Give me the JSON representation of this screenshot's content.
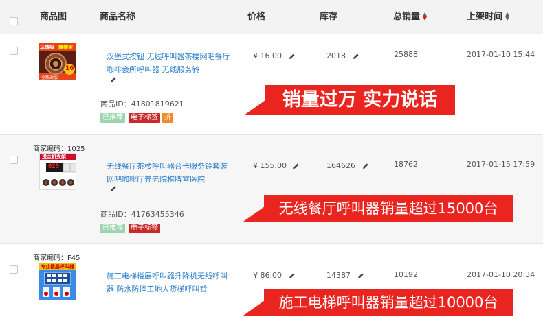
{
  "header": {
    "col_image": "商品图",
    "col_name": "商品名称",
    "col_price": "价格",
    "col_stock": "库存",
    "col_sales": "总销量",
    "col_listed": "上架时间"
  },
  "rows": [
    {
      "title": "汉堡式按钮 无线呼叫器茶楼网吧餐厅咖啡会所呼叫器 无线服务铃",
      "price": "¥ 16.00",
      "stock": "2018",
      "sales": "25888",
      "listed": "2017-01-10 15:44",
      "product_id": "商品ID：41801819621",
      "tags": [
        "已推荐",
        "电子标签",
        "折"
      ],
      "banner": "销量过万 实力说话",
      "thumb_text": [
        "玩转吸",
        "震撼型",
        "全新改版",
        "16"
      ]
    },
    {
      "merchant_code": "商家编码：1025",
      "title": "无线餐厅茶楼呼叫器台卡服务铃套装网吧咖啡厅养老院棋牌室医院",
      "price": "¥ 155.00",
      "stock": "164626",
      "sales": "18762",
      "listed": "2017-01-15 17:59",
      "product_id": "商品ID：41763455346",
      "tags": [
        "已推荐",
        "电子标签"
      ],
      "banner": "无线餐厅呼叫器销量超过15000台",
      "thumb_text": [
        "送主机支架",
        "025"
      ]
    },
    {
      "merchant_code": "商家编码：F45",
      "title": "施工电梯楼层呼叫器升降机无线呼叫器 防水防摔工地人货梯呼叫铃",
      "price": "¥ 86.00",
      "stock": "14387",
      "sales": "10192",
      "listed": "2017-01-10 20:34",
      "banner": "施工电梯呼叫器销量超过10000台",
      "thumb_text": [
        "专业楼层呼叫器"
      ]
    }
  ],
  "colors": {
    "link": "#2a7dc9",
    "banner": "#ea2520",
    "tag_recommended": "#9fd4b2",
    "tag_electronic": "#c72a2a",
    "tag_discount": "#f08a2a"
  }
}
